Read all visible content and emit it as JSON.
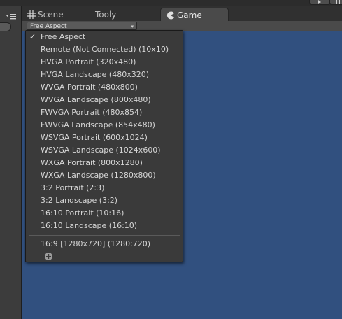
{
  "tabs": {
    "scene": "Scene",
    "tooly": "Tooly",
    "game": "Game"
  },
  "toolbar": {
    "aspect_value": "Free Aspect"
  },
  "aspect_menu": {
    "selected_index": 0,
    "items": [
      "Free Aspect",
      "Remote (Not Connected) (10x10)",
      "HVGA Portrait (320x480)",
      "HVGA Landscape (480x320)",
      "WVGA Portrait (480x800)",
      "WVGA Landscape (800x480)",
      "FWVGA Portrait (480x854)",
      "FWVGA Landscape (854x480)",
      "WSVGA Portrait (600x1024)",
      "WSVGA Landscape (1024x600)",
      "WXGA Portrait (800x1280)",
      "WXGA Landscape (1280x800)",
      "3:2 Portrait (2:3)",
      "3:2 Landscape (3:2)",
      "16:10 Portrait (10:16)",
      "16:10 Landscape (16:10)"
    ],
    "custom_items": [
      "16:9 [1280x720] (1280:720)"
    ]
  },
  "icons": {
    "scene_tab": "grid-icon",
    "game_tab": "pacman-icon",
    "panel_menu": "hamburger-icon",
    "selected": "checkmark-icon",
    "add": "plus-circle-icon",
    "dropdown": "chevron-down-icon",
    "play": "play-icon",
    "pause": "pause-icon"
  },
  "colors": {
    "viewport_bg": "#31507f",
    "menu_bg": "#3a3a3a",
    "editor_bg": "#3a3a3a"
  }
}
